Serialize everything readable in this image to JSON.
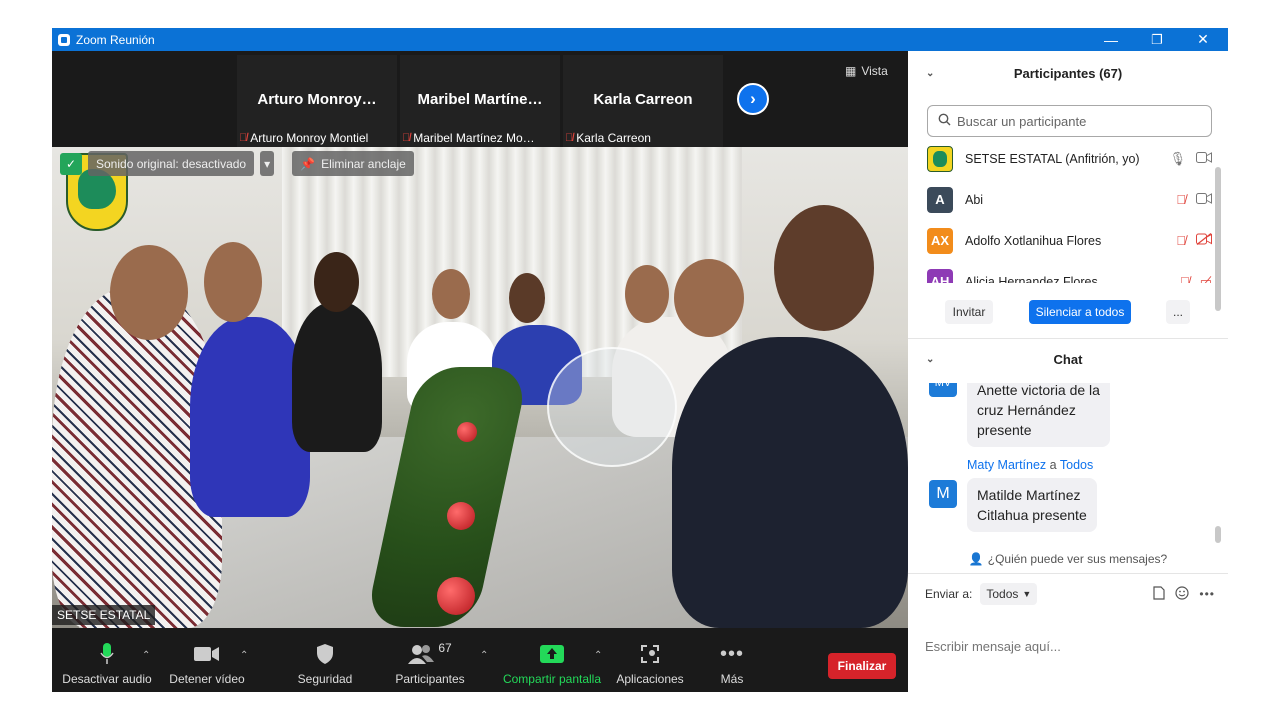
{
  "window": {
    "title": "Zoom Reunión",
    "minimize": "—",
    "restore": "❐",
    "close": "✕"
  },
  "thumbnails": [
    {
      "display_name": "Arturo  Monroy…",
      "full_name": "Arturo Monroy Montiel"
    },
    {
      "display_name": "Maribel  Martíne…",
      "full_name": "Maribel Martínez Mo…"
    },
    {
      "display_name": "Karla Carreon",
      "full_name": "Karla Carreon"
    }
  ],
  "view_button": "Vista",
  "video_overlay": {
    "original_sound": "Sonido original: desactivado",
    "unpin": "Eliminar anclaje",
    "active_speaker": "SETSE ESTATAL"
  },
  "toolbar": {
    "mute": "Desactivar audio",
    "stop_video": "Detener vídeo",
    "security": "Seguridad",
    "participants": "Participantes",
    "participant_count": "67",
    "share": "Compartir pantalla",
    "apps": "Aplicaciones",
    "more": "Más",
    "end": "Finalizar"
  },
  "participants_panel": {
    "title": "Participantes (67)",
    "search_placeholder": "Buscar un participante",
    "rows": [
      {
        "initials": "",
        "name": "SETSE ESTATAL (Anfitrión, yo)",
        "color": "#f3d521"
      },
      {
        "initials": "A",
        "name": "Abi",
        "color": "#3b4a5a"
      },
      {
        "initials": "AX",
        "name": "Adolfo Xotlanihua Flores",
        "color": "#f28c1b"
      },
      {
        "initials": "AH",
        "name": "Alicia Hernandez Flores",
        "color": "#8e3ab5"
      }
    ],
    "invite": "Invitar",
    "mute_all": "Silenciar a todos",
    "more": "..."
  },
  "chat_panel": {
    "title": "Chat",
    "messages": [
      {
        "sender": "",
        "to": "",
        "avatar": "MV",
        "text_lines": [
          "Anette victoria de la",
          "cruz Hernández",
          "presente"
        ]
      },
      {
        "sender": "Maty Martínez",
        "to_word": "a",
        "to": "Todos",
        "avatar": "M",
        "text_lines": [
          "Matilde Martínez",
          "Citlahua presente"
        ]
      }
    ],
    "who_can_see": "¿Quién puede ver sus mensajes?",
    "send_to_label": "Enviar a:",
    "send_to_value": "Todos",
    "input_placeholder": "Escribir mensaje aquí..."
  },
  "colors": {
    "titlebar": "#0b72d6",
    "accent_blue": "#0e72ed",
    "end_red": "#d6232a",
    "share_green": "#23d959",
    "muted_red": "#e0433b"
  }
}
